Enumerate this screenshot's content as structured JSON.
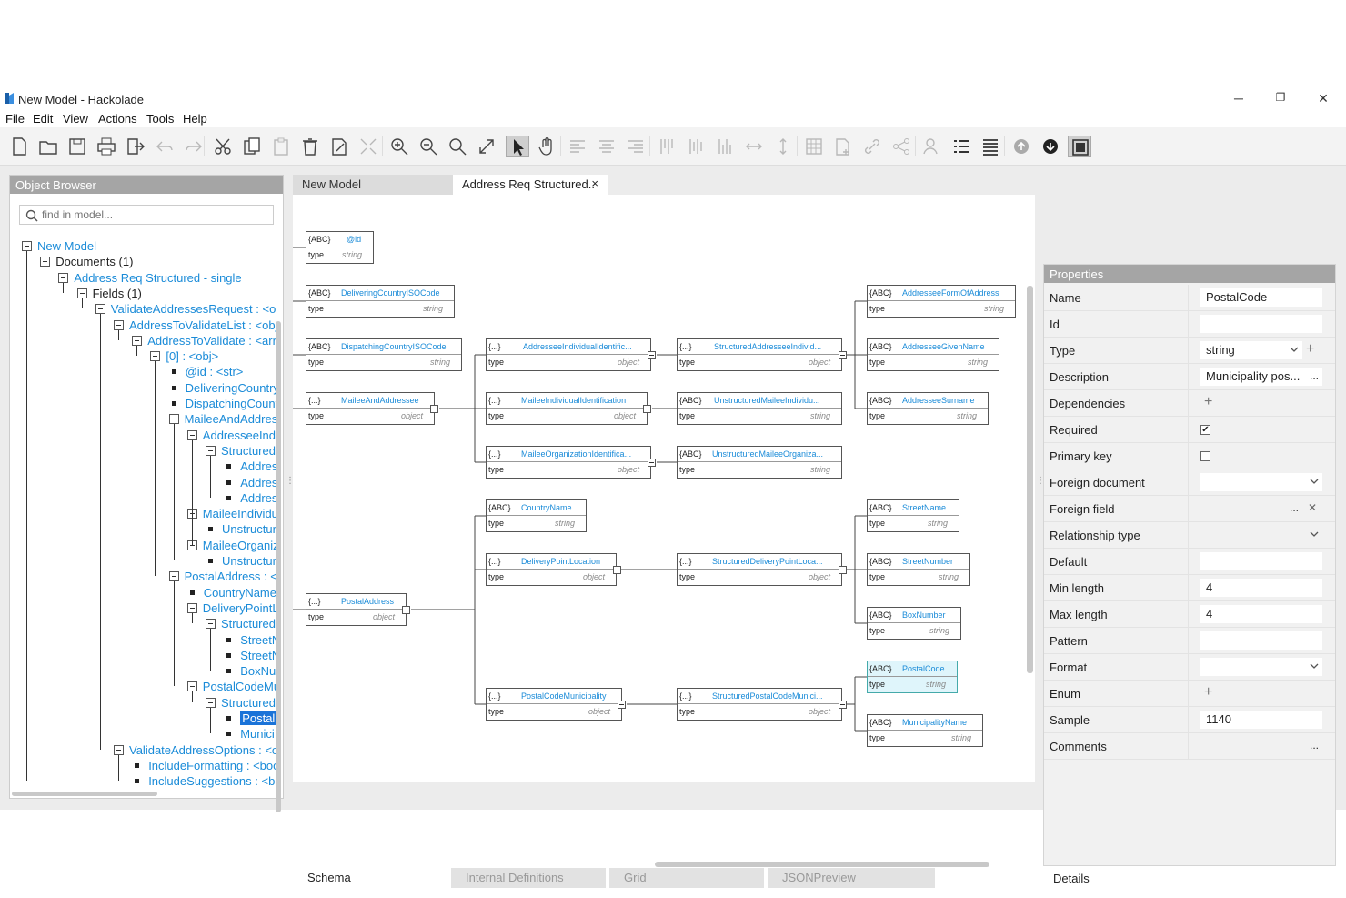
{
  "window": {
    "title": "New Model - Hackolade",
    "minimize": "─",
    "restore": "❐",
    "close": "✕"
  },
  "menu": [
    "File",
    "Edit",
    "View",
    "Actions",
    "Tools",
    "Help"
  ],
  "object_browser": {
    "title": "Object Browser",
    "search_placeholder": "find in model...",
    "tree": [
      {
        "label": "New Model",
        "blue": true
      },
      {
        "label": "Documents (1)"
      },
      {
        "label": "Address Req Structured - single",
        "blue": true
      },
      {
        "label": "Fields (1)"
      },
      {
        "label": "ValidateAddressesRequest : <ob",
        "blue": true
      },
      {
        "label": "AddressToValidateList : <obj",
        "blue": true
      },
      {
        "label": "AddressToValidate : <arr",
        "blue": true
      },
      {
        "label": "[0] : <obj>",
        "blue": true
      },
      {
        "label": "@id : <str>",
        "blue": true
      },
      {
        "label": "DeliveringCountry",
        "blue": true
      },
      {
        "label": "DispatchingCount",
        "blue": true
      },
      {
        "label": "MaileeAndAddres",
        "blue": true
      },
      {
        "label": "AddresseeIndi",
        "blue": true
      },
      {
        "label": "Structured",
        "blue": true
      },
      {
        "label": "Addres",
        "blue": true
      },
      {
        "label": "Addres",
        "blue": true
      },
      {
        "label": "Addres",
        "blue": true
      },
      {
        "label": "MaileeIndividu",
        "blue": true
      },
      {
        "label": "Unstructur",
        "blue": true
      },
      {
        "label": "MaileeOrganiz",
        "blue": true
      },
      {
        "label": "Unstructur",
        "blue": true
      },
      {
        "label": "PostalAddress : <",
        "blue": true
      },
      {
        "label": "CountryName",
        "blue": true
      },
      {
        "label": "DeliveryPointL",
        "blue": true
      },
      {
        "label": "Structured",
        "blue": true
      },
      {
        "label": "StreetN",
        "blue": true
      },
      {
        "label": "StreetN",
        "blue": true
      },
      {
        "label": "BoxNu",
        "blue": true
      },
      {
        "label": "PostalCodeMu",
        "blue": true
      },
      {
        "label": "Structured",
        "blue": true
      },
      {
        "label": "PostalC",
        "selected": true
      },
      {
        "label": "Munici",
        "blue": true
      },
      {
        "label": "ValidateAddressOptions : <o",
        "blue": true
      },
      {
        "label": "IncludeFormatting : <boo",
        "blue": true
      },
      {
        "label": "IncludeSuggestions : <bo",
        "blue": true
      }
    ]
  },
  "tabs": {
    "model": "New Model",
    "document": "Address Req Structured..",
    "close": "×"
  },
  "bottom_tabs": [
    "Schema",
    "Internal Definitions",
    "Grid",
    "JSONPreview"
  ],
  "diagram": {
    "entities": [
      {
        "tag": "{ABC}",
        "name": "@id",
        "type": "string"
      },
      {
        "tag": "{ABC}",
        "name": "DeliveringCountryISOCode",
        "type": "string"
      },
      {
        "tag": "{ABC}",
        "name": "DispatchingCountryISOCode",
        "type": "string"
      },
      {
        "tag": "{...}",
        "name": "MaileeAndAddressee",
        "type": "object"
      },
      {
        "tag": "{...}",
        "name": "AddresseeIndividualIdentific...",
        "type": "object"
      },
      {
        "tag": "{...}",
        "name": "MaileeIndividualIdentification",
        "type": "object"
      },
      {
        "tag": "{...}",
        "name": "MaileeOrganizationIdentifica...",
        "type": "object"
      },
      {
        "tag": "{...}",
        "name": "StructuredAddresseeIndivid...",
        "type": "object"
      },
      {
        "tag": "{ABC}",
        "name": "UnstructuredMaileeIndividu...",
        "type": "string"
      },
      {
        "tag": "{ABC}",
        "name": "UnstructuredMaileeOrganiza...",
        "type": "string"
      },
      {
        "tag": "{ABC}",
        "name": "AddresseeFormOfAddress",
        "type": "string"
      },
      {
        "tag": "{ABC}",
        "name": "AddresseeGivenName",
        "type": "string"
      },
      {
        "tag": "{ABC}",
        "name": "AddresseeSurname",
        "type": "string"
      },
      {
        "tag": "{...}",
        "name": "PostalAddress",
        "type": "object"
      },
      {
        "tag": "{ABC}",
        "name": "CountryName",
        "type": "string"
      },
      {
        "tag": "{...}",
        "name": "DeliveryPointLocation",
        "type": "object"
      },
      {
        "tag": "{...}",
        "name": "PostalCodeMunicipality",
        "type": "object"
      },
      {
        "tag": "{...}",
        "name": "StructuredDeliveryPointLoca...",
        "type": "object"
      },
      {
        "tag": "{...}",
        "name": "StructuredPostalCodeMunici...",
        "type": "object"
      },
      {
        "tag": "{ABC}",
        "name": "StreetName",
        "type": "string"
      },
      {
        "tag": "{ABC}",
        "name": "StreetNumber",
        "type": "string"
      },
      {
        "tag": "{ABC}",
        "name": "BoxNumber",
        "type": "string"
      },
      {
        "tag": "{ABC}",
        "name": "PostalCode",
        "type": "string"
      },
      {
        "tag": "{ABC}",
        "name": "MunicipalityName",
        "type": "string"
      }
    ],
    "type_label": "type"
  },
  "properties": {
    "title": "Properties",
    "rows": [
      {
        "label": "Name",
        "value": "PostalCode",
        "kind": "text"
      },
      {
        "label": "Id",
        "value": "",
        "kind": "text"
      },
      {
        "label": "Type",
        "value": "string",
        "kind": "select-plus"
      },
      {
        "label": "Description",
        "value": "Municipality pos...",
        "kind": "text-dots"
      },
      {
        "label": "Dependencies",
        "value": "",
        "kind": "plus"
      },
      {
        "label": "Required",
        "value": "✔",
        "kind": "check"
      },
      {
        "label": "Primary key",
        "value": "",
        "kind": "check"
      },
      {
        "label": "Foreign document",
        "value": "",
        "kind": "select"
      },
      {
        "label": "Foreign field",
        "value": "",
        "kind": "dots-x"
      },
      {
        "label": "Relationship type",
        "value": "",
        "kind": "select-gray"
      },
      {
        "label": "Default",
        "value": "",
        "kind": "text"
      },
      {
        "label": "Min length",
        "value": "4",
        "kind": "text"
      },
      {
        "label": "Max length",
        "value": "4",
        "kind": "text"
      },
      {
        "label": "Pattern",
        "value": "",
        "kind": "text"
      },
      {
        "label": "Format",
        "value": "",
        "kind": "select"
      },
      {
        "label": "Enum",
        "value": "",
        "kind": "plus"
      },
      {
        "label": "Sample",
        "value": "1140",
        "kind": "text"
      },
      {
        "label": "Comments",
        "value": "",
        "kind": "dots-gray"
      }
    ],
    "details_tab": "Details",
    "dots": "...",
    "plus": "+",
    "x": "✕"
  }
}
